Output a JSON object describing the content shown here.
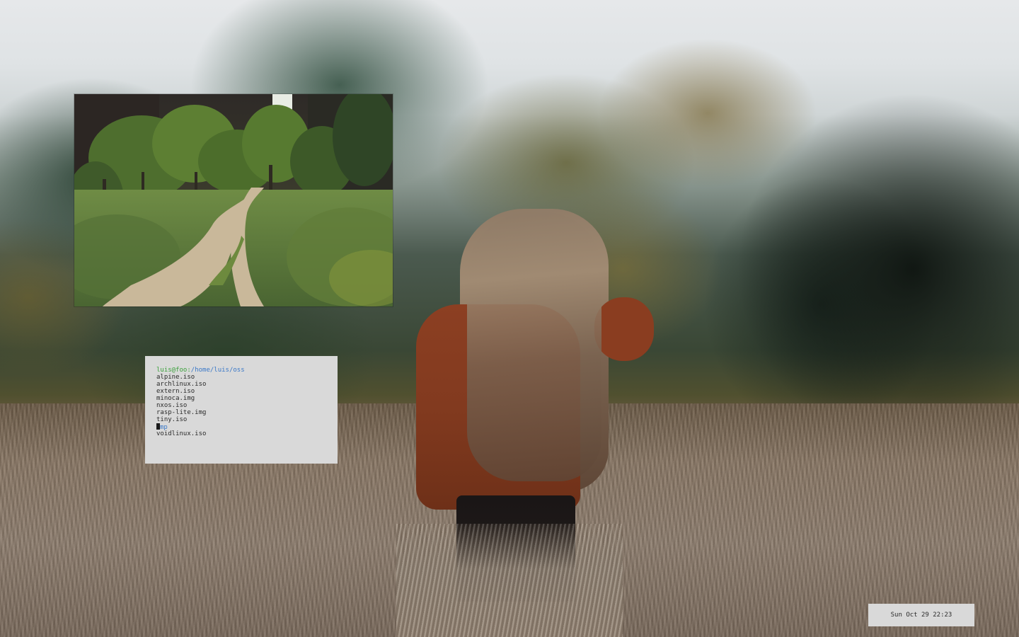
{
  "desktop": {
    "wallpaper_icon": "photo-wallpaper-field"
  },
  "image_viewer": {
    "image_icon": "forest-path-photo"
  },
  "terminal": {
    "prompt_user": "luis@foo",
    "prompt_separator": ":",
    "prompt_path": "/home/luis/oss",
    "entries": [
      {
        "name": "alpine.iso"
      },
      {
        "name": "archlinux.iso"
      },
      {
        "name": "extern.iso"
      },
      {
        "name": "minoca.img"
      },
      {
        "name": "nxos.iso"
      },
      {
        "name": "rasp-lite.img"
      },
      {
        "name": "tiny.iso"
      },
      {
        "name": "tmp"
      },
      {
        "name": "voidlinux.iso"
      }
    ],
    "cursor_entry_first_char": "t",
    "cursor_entry_rest": "mp"
  },
  "clock": {
    "text": "Sun Oct 29 22:23"
  },
  "colors": {
    "terminal_bg": "#d9d9d9",
    "prompt_user": "#3aa03a",
    "prompt_path": "#3a78c8",
    "directory": "#3a78c8"
  }
}
